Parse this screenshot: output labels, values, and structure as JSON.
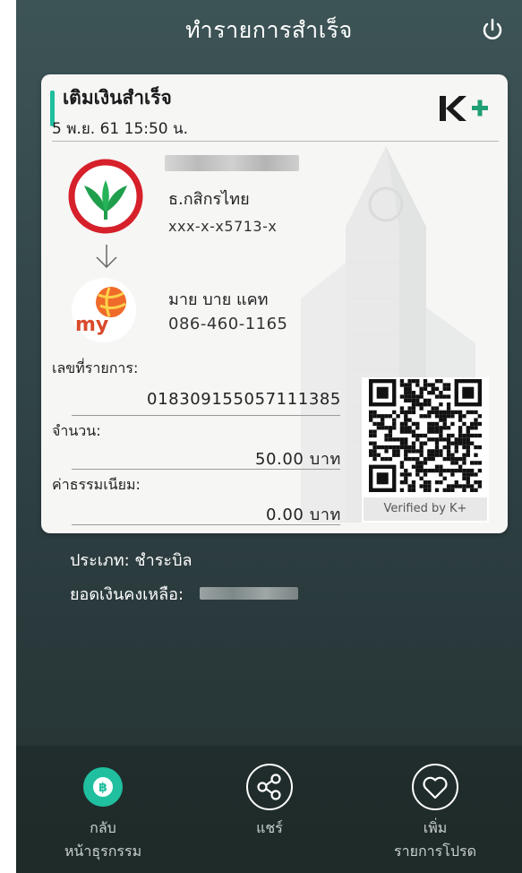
{
  "header": {
    "title": "ทำรายการสำเร็จ",
    "power_icon": "power-icon"
  },
  "card": {
    "title": "เติมเงินสำเร็จ",
    "datetime": "5 พ.ย. 61  15:50 น.",
    "brand_logo": "K+",
    "sender": {
      "bank": "ธ.กสิกรไทย",
      "account": "xxx-x-x5713-x"
    },
    "receiver": {
      "name": "มาย บาย แคท",
      "phone": "086-460-1165"
    },
    "reference": {
      "label": "เลขที่รายการ:",
      "value": "018309155057111385"
    },
    "amount": {
      "label": "จำนวน:",
      "value": "50.00 บาท"
    },
    "fee": {
      "label": "ค่าธรรมเนียม:",
      "value": "0.00 บาท"
    },
    "qr_caption": "Verified by K+"
  },
  "info": {
    "type": "ประเภท: ชำระบิล",
    "balance_label": "ยอดเงินคงเหลือ:"
  },
  "bottom_nav": {
    "back_line1": "กลับ",
    "back_line2": "หน้าธุรกรรม",
    "share": "แชร์",
    "fav_line1": "เพิ่ม",
    "fav_line2": "รายการโปรด"
  },
  "colors": {
    "accent": "#1fbf9f",
    "kplus_green": "#1f9f74",
    "kbank_red": "#d6202a",
    "background": "#33474a"
  }
}
